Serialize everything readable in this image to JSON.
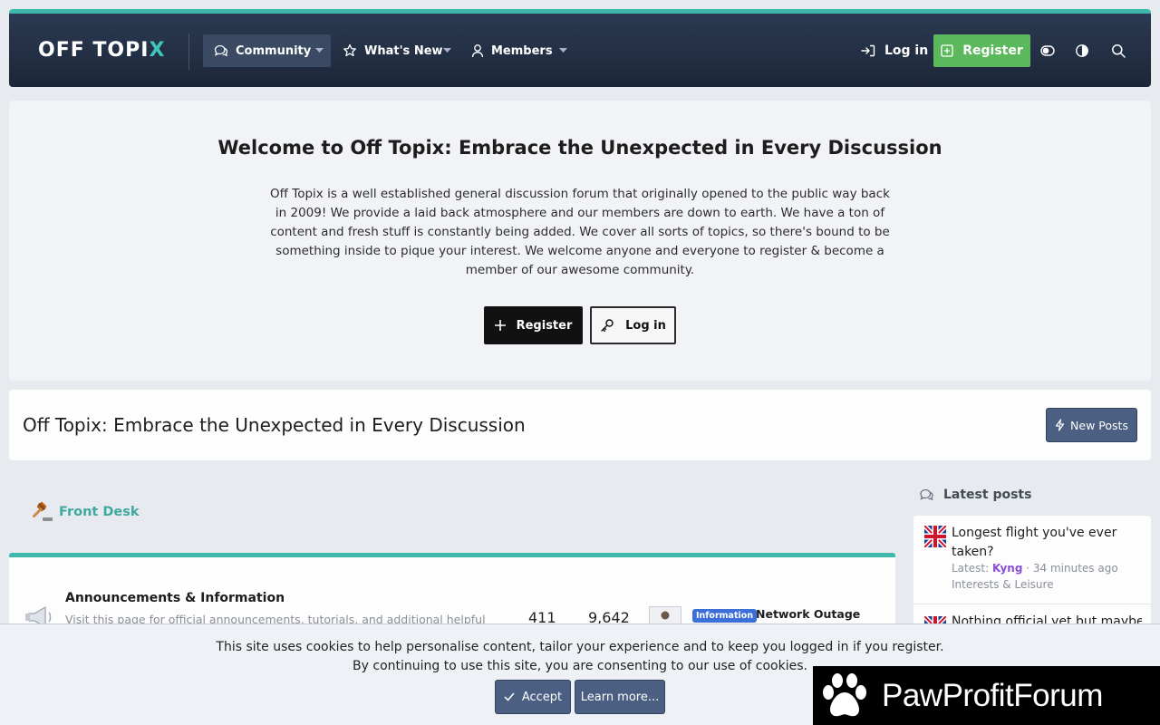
{
  "header": {
    "logo": {
      "main": "OFF TOPI",
      "accent": "X"
    },
    "nav": [
      {
        "label": "Community",
        "icon": "chat-icon"
      },
      {
        "label": "What's New",
        "icon": "star-icon"
      },
      {
        "label": "Members",
        "icon": "user-icon"
      }
    ],
    "login_label": "Log in",
    "register_label": "Register"
  },
  "welcome": {
    "title": "Welcome to Off Topix: Embrace the Unexpected in Every Discussion",
    "text": "Off Topix is a well established general discussion forum that originally opened to the public way back in 2009! We provide a laid back atmosphere and our members are down to earth. We have a ton of content and fresh stuff is constantly being added. We cover all sorts of topics, so there's bound to be something inside to pique your interest. We welcome anyone and everyone to register & become a member of our awesome community.",
    "register_label": "Register",
    "login_label": "Log in"
  },
  "page": {
    "title": "Off Topix: Embrace the Unexpected in Every Discussion",
    "new_posts_label": "New Posts"
  },
  "category": {
    "title": "Front Desk",
    "forum": {
      "title": "Announcements & Information",
      "description": "Visit this page for official announcements, tutorials, and additional helpful",
      "threads": "411",
      "messages": "9,642",
      "badge": "Information",
      "last_thread": "Network Outage"
    }
  },
  "sidebar": {
    "title": "Latest posts",
    "posts": [
      {
        "title": "Longest flight you've ever taken?",
        "latest_prefix": "Latest: ",
        "user": "Kyng",
        "time": " · 34 minutes ago",
        "forum": "Interests & Leisure"
      },
      {
        "title": "Nothing official yet but maybe"
      }
    ]
  },
  "cookie": {
    "line1": "This site uses cookies to help personalise content, tailor your experience and to keep you logged in if you register.",
    "line2": "By continuing to use this site, you are consenting to our use of cookies.",
    "accept_label": "Accept",
    "learn_label": "Learn more..."
  },
  "watermark": {
    "text": "PawProfitForum"
  },
  "colors": {
    "accent": "#3fb7ac",
    "register_green": "#5cb85c",
    "button_blue": "#4b5f82",
    "header_dark": "#1c2638",
    "badge_blue": "#3c6fd8",
    "username_purple": "#8a4fd8"
  }
}
